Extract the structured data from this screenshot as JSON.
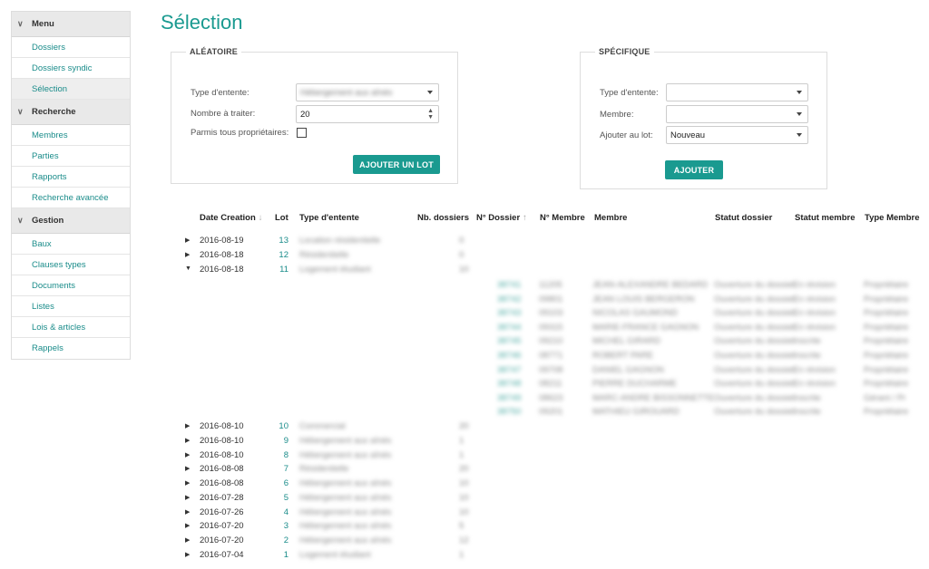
{
  "sidebar": {
    "sections": [
      {
        "title": "Menu",
        "items": [
          "Dossiers",
          "Dossiers syndic",
          "Sélection"
        ]
      },
      {
        "title": "Recherche",
        "items": [
          "Membres",
          "Parties",
          "Rapports",
          "Recherche avancée"
        ]
      },
      {
        "title": "Gestion",
        "items": [
          "Baux",
          "Clauses types",
          "Documents",
          "Listes",
          "Lois & articles",
          "Rappels"
        ]
      }
    ]
  },
  "page": {
    "title": "Sélection"
  },
  "aleatoire": {
    "legend": "ALÉATOIRE",
    "type_label": "Type d'entente:",
    "type_value": "Hébergement aux aînés",
    "nombre_label": "Nombre à traiter:",
    "nombre_value": "20",
    "parmis_label": "Parmis tous propriétaires:",
    "button": "AJOUTER UN LOT"
  },
  "specifique": {
    "legend": "SPÉCIFIQUE",
    "type_label": "Type d'entente:",
    "type_value": "",
    "membre_label": "Membre:",
    "membre_value": "",
    "lot_label": "Ajouter au lot:",
    "lot_value": "Nouveau",
    "button": "AJOUTER"
  },
  "table": {
    "headers": {
      "date": "Date Creation",
      "lot": "Lot",
      "type": "Type d'entente",
      "nb": "Nb. dossiers",
      "dossier": "N° Dossier",
      "num_membre": "N° Membre",
      "membre": "Membre",
      "statut_dossier": "Statut dossier",
      "statut_membre": "Statut membre",
      "type_membre": "Type Membre"
    },
    "rows": [
      {
        "date": "2016-08-19",
        "lot": "13",
        "type": "Location résidentielle",
        "nb": "0",
        "expanded": false
      },
      {
        "date": "2016-08-18",
        "lot": "12",
        "type": "Résidentielle",
        "nb": "0",
        "expanded": false
      },
      {
        "date": "2016-08-18",
        "lot": "11",
        "type": "Logement étudiant",
        "nb": "10",
        "expanded": true
      },
      {
        "date": "2016-08-10",
        "lot": "10",
        "type": "Commercial",
        "nb": "20",
        "expanded": false
      },
      {
        "date": "2016-08-10",
        "lot": "9",
        "type": "Hébergement aux aînés",
        "nb": "1",
        "expanded": false
      },
      {
        "date": "2016-08-10",
        "lot": "8",
        "type": "Hébergement aux aînés",
        "nb": "1",
        "expanded": false
      },
      {
        "date": "2016-08-08",
        "lot": "7",
        "type": "Résidentielle",
        "nb": "20",
        "expanded": false
      },
      {
        "date": "2016-08-08",
        "lot": "6",
        "type": "Hébergement aux aînés",
        "nb": "10",
        "expanded": false
      },
      {
        "date": "2016-07-28",
        "lot": "5",
        "type": "Hébergement aux aînés",
        "nb": "10",
        "expanded": false
      },
      {
        "date": "2016-07-26",
        "lot": "4",
        "type": "Hébergement aux aînés",
        "nb": "10",
        "expanded": false
      },
      {
        "date": "2016-07-20",
        "lot": "3",
        "type": "Hébergement aux aînés",
        "nb": "5",
        "expanded": false
      },
      {
        "date": "2016-07-20",
        "lot": "2",
        "type": "Hébergement aux aînés",
        "nb": "12",
        "expanded": false
      },
      {
        "date": "2016-07-04",
        "lot": "1",
        "type": "Logement étudiant",
        "nb": "1",
        "expanded": false
      }
    ],
    "detail": [
      {
        "dossier": "38741",
        "num": "11205",
        "membre": "JEAN-ALEXANDRE BEDARD",
        "statut": "Ouverture du dossier",
        "smem": "En révision",
        "tmem": "Propriétaire"
      },
      {
        "dossier": "38742",
        "num": "09801",
        "membre": "JEAN LOUIS BERGERON",
        "statut": "Ouverture du dossier",
        "smem": "En révision",
        "tmem": "Propriétaire"
      },
      {
        "dossier": "38743",
        "num": "09103",
        "membre": "NICOLAS GAUMOND",
        "statut": "Ouverture du dossier",
        "smem": "En révision",
        "tmem": "Propriétaire"
      },
      {
        "dossier": "38744",
        "num": "09315",
        "membre": "MARIE-FRANCE GAGNON",
        "statut": "Ouverture du dossier",
        "smem": "En révision",
        "tmem": "Propriétaire"
      },
      {
        "dossier": "38745",
        "num": "09210",
        "membre": "MICHEL GIRARD",
        "statut": "Ouverture du dossier",
        "smem": "Inscrite",
        "tmem": "Propriétaire"
      },
      {
        "dossier": "38746",
        "num": "08771",
        "membre": "ROBERT PARE",
        "statut": "Ouverture du dossier",
        "smem": "Inscrite",
        "tmem": "Propriétaire"
      },
      {
        "dossier": "38747",
        "num": "09708",
        "membre": "DANIEL GAGNON",
        "statut": "Ouverture du dossier",
        "smem": "En révision",
        "tmem": "Propriétaire"
      },
      {
        "dossier": "38748",
        "num": "08211",
        "membre": "PIERRE DUCHARME",
        "statut": "Ouverture du dossier",
        "smem": "En révision",
        "tmem": "Propriétaire"
      },
      {
        "dossier": "38749",
        "num": "08623",
        "membre": "MARC-ANDRE BISSONNETTE",
        "statut": "Ouverture du dossier",
        "smem": "Inscrite",
        "tmem": "Gérant / Pr"
      },
      {
        "dossier": "38750",
        "num": "09201",
        "membre": "MATHIEU GIROUARD",
        "statut": "Ouverture du dossier",
        "smem": "Inscrite",
        "tmem": "Propriétaire"
      }
    ]
  }
}
